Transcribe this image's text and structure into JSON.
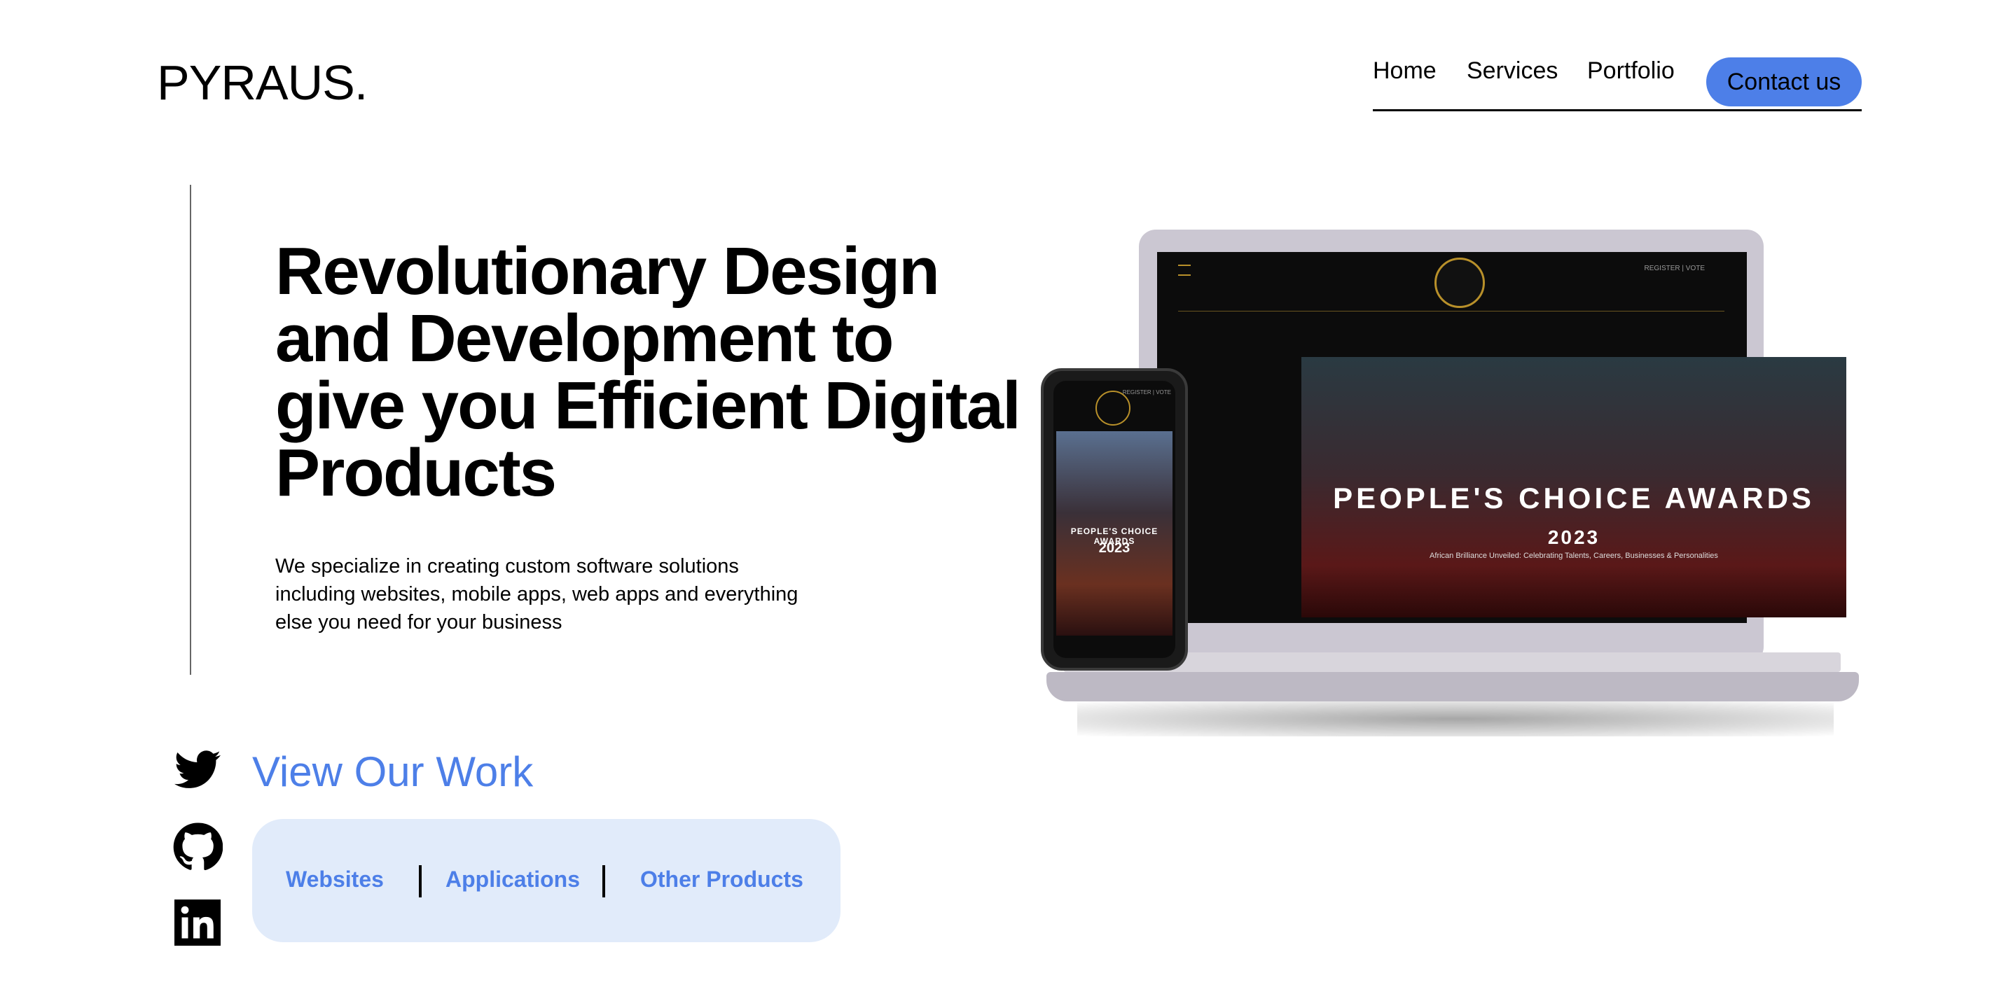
{
  "brand": {
    "logo": "PYRAUS."
  },
  "nav": {
    "home": "Home",
    "services": "Services",
    "portfolio": "Portfolio",
    "contact": "Contact us"
  },
  "hero": {
    "heading": "Revolutionary Design and Development to give you Efficient Digital Products",
    "description": "We specialize in creating custom software solutions including websites, mobile apps, web apps and everything else you need for your business"
  },
  "work": {
    "view_link": "View Our Work",
    "categories": [
      "Websites",
      "Applications",
      "Other Products"
    ]
  },
  "social": {
    "icons": [
      "twitter-icon",
      "github-icon",
      "linkedin-icon"
    ]
  },
  "mockup": {
    "laptop": {
      "title": "PEOPLE'S CHOICE AWARDS",
      "year": "2023",
      "subtitle": "African Brilliance Unveiled: Celebrating Talents, Careers, Businesses & Personalities",
      "links": "REGISTER | VOTE"
    },
    "phone": {
      "title": "PEOPLE'S CHOICE AWARDS",
      "year": "2023",
      "links": "REGISTER | VOTE"
    }
  },
  "colors": {
    "accent": "#4d7fe8",
    "work_box_bg": "#e1ebfa"
  }
}
